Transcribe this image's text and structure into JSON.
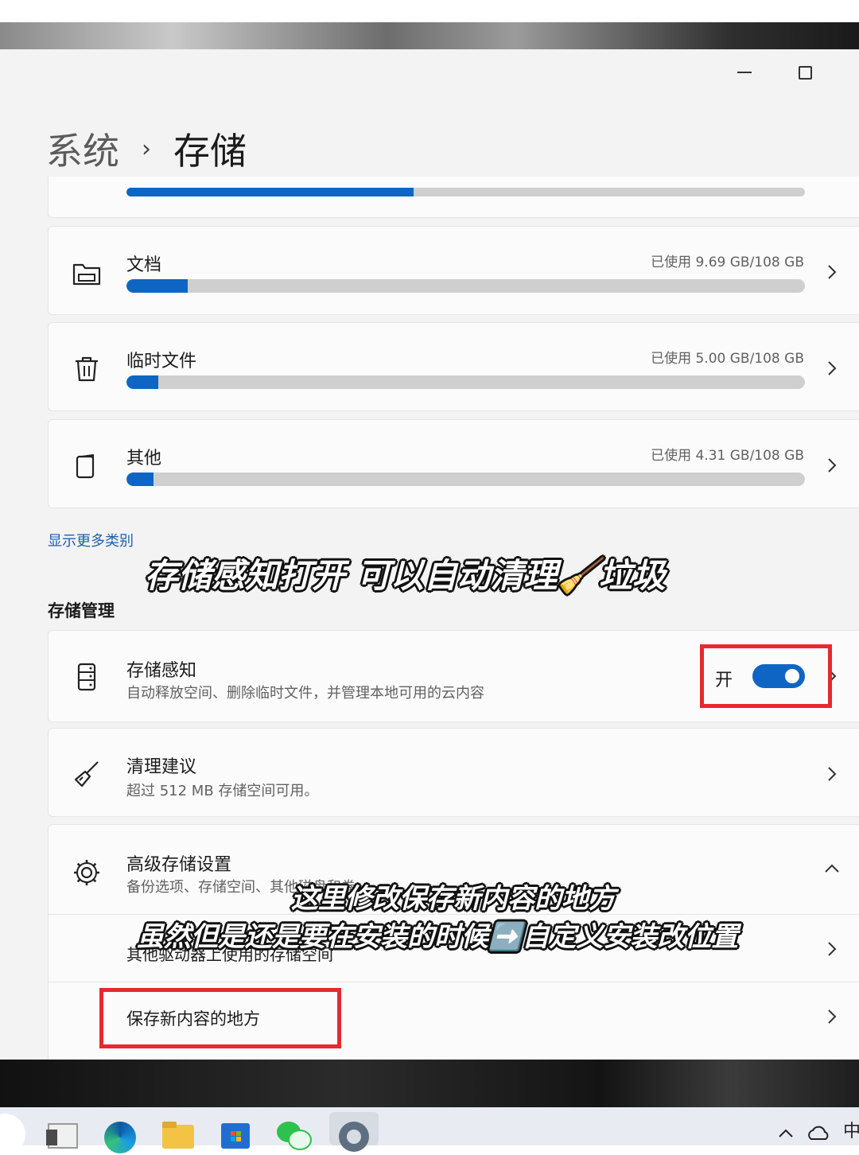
{
  "breadcrumb": {
    "parent": "系统",
    "separator": "›",
    "current": "存储"
  },
  "categories": [
    {
      "name": "文档",
      "usage": "已使用 9.69 GB/108 GB",
      "icon": "folder-icon",
      "fill": 0.09
    },
    {
      "name": "临时文件",
      "usage": "已使用 5.00 GB/108 GB",
      "icon": "trash-icon",
      "fill": 0.047
    },
    {
      "name": "其他",
      "usage": "已使用 4.31 GB/108 GB",
      "icon": "copy-icon",
      "fill": 0.04
    }
  ],
  "top_partial_bar_fill": 0.423,
  "show_more_link": "显示更多类别",
  "storage_management": {
    "heading": "存储管理",
    "storage_sense": {
      "title": "存储感知",
      "subtitle": "自动释放空间、删除临时文件，并管理本地可用的云内容",
      "toggle_label": "开",
      "toggle_on": true
    },
    "cleanup": {
      "title": "清理建议",
      "subtitle": "超过 512 MB 存储空间可用。"
    },
    "advanced": {
      "title": "高级存储设置",
      "subtitle": "备份选项、存储空间、其他磁盘和卷",
      "subitems": [
        "其他驱动器上使用的存储空间",
        "保存新内容的地方"
      ]
    }
  },
  "captions": {
    "storage_sense": "存储感知打开 可以自动清理🧹垃圾",
    "save_location_1": "这里修改保存新内容的地方",
    "save_location_2": "虽然但是还是要在安装的时候➡️自定义安装改位置"
  },
  "taskbar": {
    "apps": [
      "file-explorer-icon",
      "edge-icon",
      "folder-icon",
      "store-icon",
      "wechat-icon",
      "settings-icon"
    ],
    "tray_ime": "中"
  },
  "colors": {
    "accent": "#0f65c4",
    "highlight": "#e8282f"
  }
}
